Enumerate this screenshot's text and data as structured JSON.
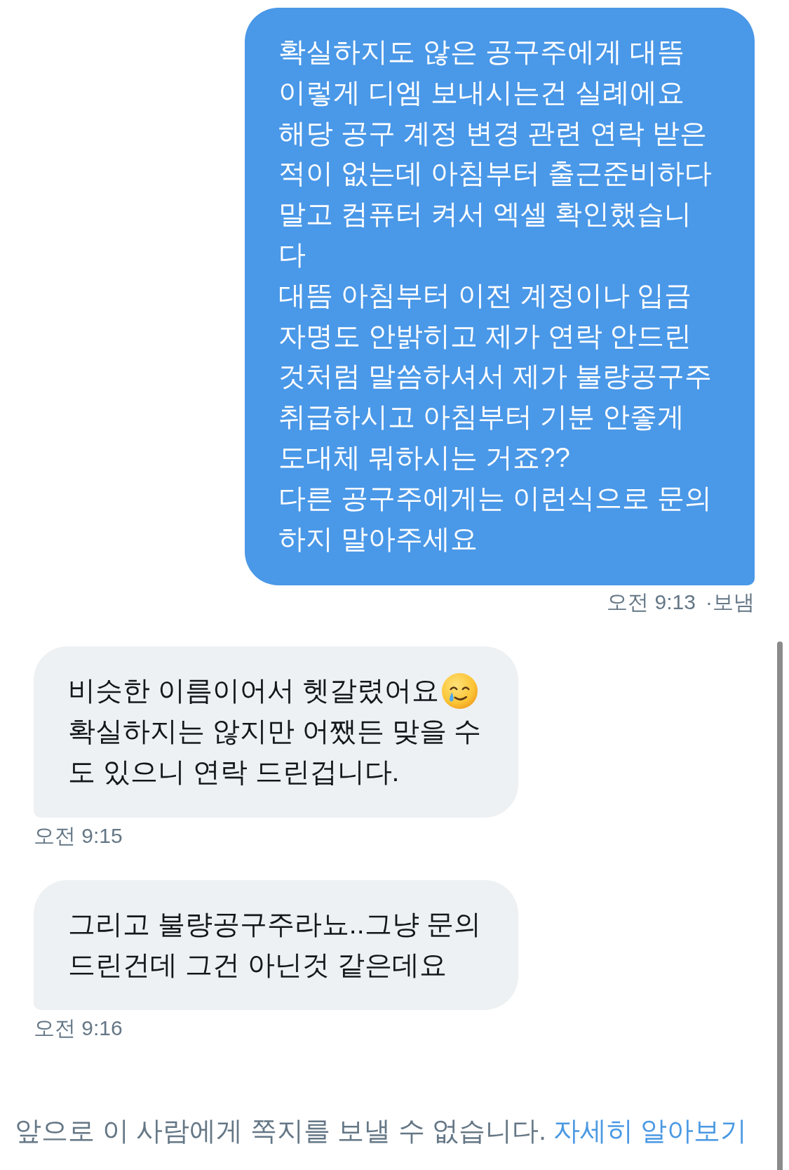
{
  "messages": [
    {
      "kind": "sent",
      "paragraphs": [
        {
          "lines": [
            "확실하지도 않은 공구주에게 대뜸",
            "이렇게 디엠 보내시는건 실례에요"
          ]
        },
        {
          "lines": [
            "해당 공구 계정 변경 관련 연락 받은",
            "적이 없는데 아침부터 출근준비하다",
            "말고 컴퓨터 켜서 엑셀 확인했습니",
            "다"
          ]
        },
        {
          "lines": [
            "대뜸 아침부터 이전 계정이나 입금",
            "자명도 안밝히고 제가 연락 안드린",
            "것처럼 말씀하셔서 제가 불량공구주",
            "취급하시고 아침부터 기분 안좋게",
            "도대체 뭐하시는 거죠??"
          ]
        },
        {
          "lines": [
            "다른 공구주에게는 이런식으로 문의",
            "하지 말아주세요"
          ]
        }
      ],
      "timestamp": "오전 9:13",
      "status": "·보냄"
    },
    {
      "kind": "received",
      "paragraphs": [
        {
          "lines": [
            "비슷한 이름이어서 헷갈렸어요"
          ],
          "trailing_emoji": true
        },
        {
          "lines": [
            "확실하지는 않지만 어쨌든 맞을 수",
            "도 있으니 연락 드린겁니다."
          ]
        }
      ],
      "timestamp": "오전 9:15"
    },
    {
      "kind": "received",
      "paragraphs": [
        {
          "lines": [
            "그리고 불량공구주라뇨..그냥 문의",
            "드린건데 그건 아닌것 같은데요"
          ]
        }
      ],
      "timestamp": "오전 9:16"
    }
  ],
  "notice": {
    "text": "앞으로 이 사람에게 쪽지를 보낼 수 없습니다.",
    "link": "자세히 알아보기"
  }
}
